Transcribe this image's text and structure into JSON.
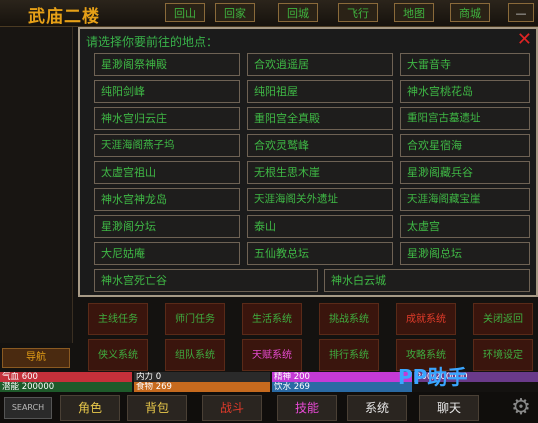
{
  "header": {
    "title": "武庙二楼",
    "buttons": [
      "回山",
      "回家",
      "回城",
      "飞行",
      "地图",
      "商城"
    ],
    "dash": "—"
  },
  "dialog": {
    "title": "请选择你要前往的地点：",
    "close": "✕",
    "places": [
      "星渺阁祭神殿",
      "合欢逍遥居",
      "大雷音寺",
      "纯阳剑峰",
      "纯阳祖屋",
      "神水宫桃花岛",
      "神水宫归云庄",
      "重阳宫全真殿",
      "重阳宫古墓遗址",
      "天涯海阁燕子坞",
      "合欢灵鹫峰",
      "合欢星宿海",
      "太虚宫祖山",
      "无根生思木崖",
      "星渺阁藏兵谷",
      "神水宫神龙岛",
      "天涯海阁关外遗址",
      "天涯海阁藏宝崖",
      "星渺阁分坛",
      "泰山",
      "太虚宫",
      "大尼姑庵",
      "五仙教总坛",
      "星渺阁总坛",
      "神水宫死亡谷",
      "神水白云城"
    ]
  },
  "actions": [
    "主线任务",
    "师门任务",
    "生活系统",
    "挑战系统",
    "成就系统",
    "关闭返回",
    "侠义系统",
    "组队系统",
    "天赋系统",
    "排行系统",
    "攻略系统",
    "环境设定"
  ],
  "left": {
    "button": "导航"
  },
  "stats": {
    "hp": "气血 600",
    "inner": "内力 0",
    "spirit": "精神 200",
    "exp": "潜能 200000",
    "food": "食物 269",
    "drink": "饮水 269",
    "extra": "200/200000"
  },
  "bottom": {
    "tabs": [
      "角色",
      "背包",
      "战斗",
      "技能",
      "系统",
      "聊天"
    ],
    "logo": "SEARCH"
  },
  "watermark": "PP助手",
  "colors": {
    "accent": "#e6a017",
    "green": "#3fb845",
    "red": "#e23b2a",
    "pink": "#e64ad0"
  }
}
